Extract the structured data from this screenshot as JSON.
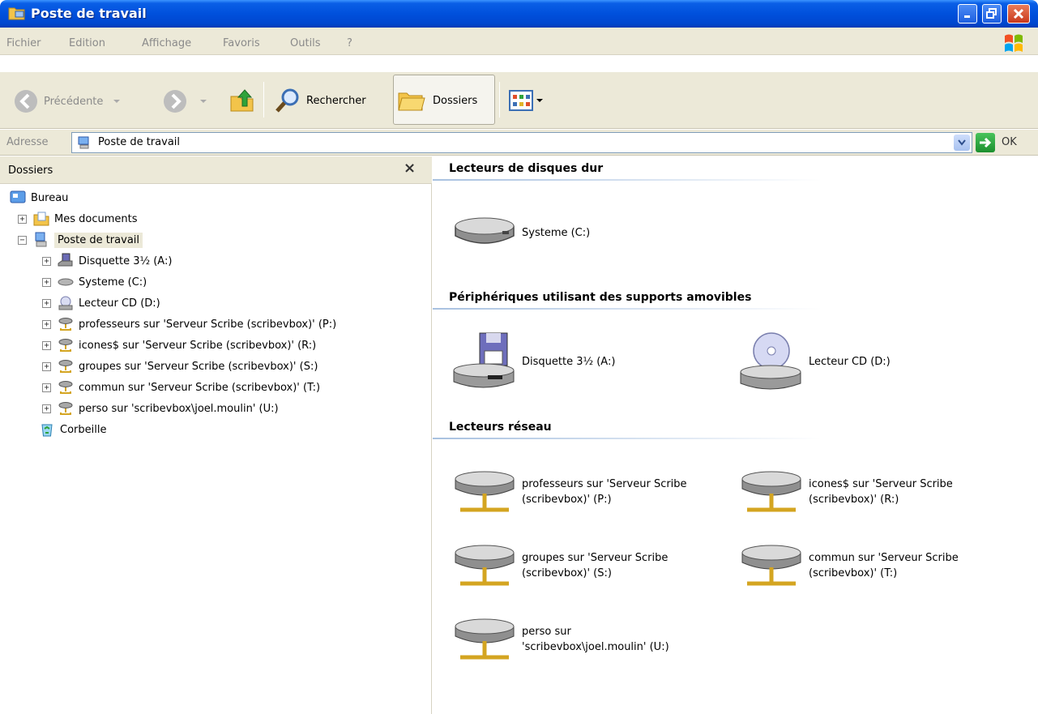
{
  "window": {
    "title": "Poste de travail",
    "icon": "folder-computer-icon"
  },
  "menu": {
    "items": [
      "Fichier",
      "Edition",
      "Affichage",
      "Favoris",
      "Outils",
      "?"
    ]
  },
  "toolbar": {
    "back_label": "Précédente",
    "search_label": "Rechercher",
    "folders_label": "Dossiers"
  },
  "address": {
    "label": "Adresse",
    "value": "Poste de travail",
    "go_label": "OK"
  },
  "folders_pane": {
    "title": "Dossiers",
    "tree": [
      {
        "label": "Bureau",
        "icon": "desktop-icon",
        "level": 0,
        "expander": ""
      },
      {
        "label": "Mes documents",
        "icon": "documents-folder-icon",
        "level": 1,
        "expander": "+"
      },
      {
        "label": "Poste de travail",
        "icon": "my-computer-icon",
        "level": 1,
        "expander": "-",
        "selected": true
      },
      {
        "label": "Disquette 3½ (A:)",
        "icon": "floppy-drive-icon",
        "level": 2,
        "expander": "+"
      },
      {
        "label": "Systeme (C:)",
        "icon": "hard-disk-icon",
        "level": 2,
        "expander": "+"
      },
      {
        "label": "Lecteur CD (D:)",
        "icon": "cd-drive-icon",
        "level": 2,
        "expander": "+"
      },
      {
        "label": "professeurs sur 'Serveur Scribe (scribevbox)' (P:)",
        "icon": "network-drive-icon",
        "level": 2,
        "expander": "+"
      },
      {
        "label": "icones$ sur 'Serveur Scribe (scribevbox)' (R:)",
        "icon": "network-drive-icon",
        "level": 2,
        "expander": "+"
      },
      {
        "label": "groupes sur 'Serveur Scribe (scribevbox)' (S:)",
        "icon": "network-drive-icon",
        "level": 2,
        "expander": "+"
      },
      {
        "label": "commun sur 'Serveur Scribe (scribevbox)' (T:)",
        "icon": "network-drive-icon",
        "level": 2,
        "expander": "+"
      },
      {
        "label": "perso sur 'scribevbox\\joel.moulin' (U:)",
        "icon": "network-drive-icon",
        "level": 2,
        "expander": "+"
      },
      {
        "label": "Corbeille",
        "icon": "recycle-bin-icon",
        "level": 1,
        "expander": ""
      }
    ]
  },
  "content": {
    "groups": [
      {
        "title": "Lecteurs de disques dur",
        "items": [
          {
            "label": "Systeme (C:)",
            "icon": "hard-disk-icon"
          }
        ]
      },
      {
        "title": "Périphériques utilisant des supports amovibles",
        "items": [
          {
            "label": "Disquette 3½ (A:)",
            "icon": "floppy-drive-icon"
          },
          {
            "label": "Lecteur CD (D:)",
            "icon": "cd-drive-icon"
          }
        ]
      },
      {
        "title": "Lecteurs réseau",
        "items": [
          {
            "label": "professeurs sur 'Serveur Scribe (scribevbox)' (P:)",
            "icon": "network-drive-icon"
          },
          {
            "label": "icones$ sur 'Serveur Scribe (scribevbox)' (R:)",
            "icon": "network-drive-icon"
          },
          {
            "label": "groupes sur 'Serveur Scribe (scribevbox)' (S:)",
            "icon": "network-drive-icon"
          },
          {
            "label": "commun sur 'Serveur Scribe (scribevbox)' (T:)",
            "icon": "network-drive-icon"
          },
          {
            "label": "perso sur 'scribevbox\\joel.moulin' (U:)",
            "icon": "network-drive-icon"
          }
        ]
      }
    ]
  },
  "colors": {
    "titlebar": "#0050dc",
    "chrome": "#ece9d8",
    "group_line": "#a8c1e0"
  }
}
